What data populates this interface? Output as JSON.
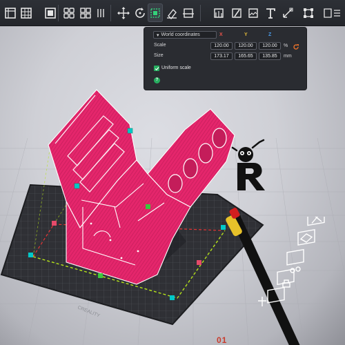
{
  "toolbar": {
    "buttons": [
      {
        "icon": "cube-icon"
      },
      {
        "icon": "grid-layout-icon"
      },
      {
        "icon": "image-icon"
      },
      {
        "icon": "arrange-icon"
      },
      {
        "icon": "split-objects-icon"
      },
      {
        "icon": "move-icon"
      },
      {
        "icon": "rotate-icon"
      },
      {
        "icon": "scale-icon"
      },
      {
        "icon": "place-on-face-icon"
      },
      {
        "icon": "cut-icon"
      },
      {
        "icon": "support-painting-icon"
      },
      {
        "icon": "seam-painting-icon"
      },
      {
        "icon": "fuzzy-skin-icon"
      },
      {
        "icon": "text-tool-icon"
      },
      {
        "icon": "measure-icon"
      },
      {
        "icon": "assembly-icon"
      }
    ],
    "active_tool": "scale-icon"
  },
  "scale_panel": {
    "coordinate_system": "World coordinates",
    "axes": {
      "x": "X",
      "y": "Y",
      "z": "Z"
    },
    "axis_colors": {
      "x": "#e8534a",
      "y": "#e2b93b",
      "z": "#4a9bea"
    },
    "scale_label": "Scale",
    "scale": {
      "x": "120.00",
      "y": "120.00",
      "z": "120.00"
    },
    "scale_unit": "%",
    "size_label": "Size",
    "size": {
      "x": "173.17",
      "y": "165.65",
      "z": "135.85"
    },
    "size_unit": "mm",
    "uniform_scale_label": "Uniform scale",
    "uniform_scale": true,
    "help_glyph": "?"
  },
  "scene": {
    "model_color": "#e5266c",
    "bed_brand": "CREALITY",
    "plate_number": "01",
    "accent_handle_color": "#00c8c8"
  },
  "side_toolbar": [
    {
      "icon": "delete-plate-icon"
    },
    {
      "icon": "orient-icon"
    },
    {
      "icon": "arrange-plate-icon"
    },
    {
      "icon": "lock-plate-icon"
    },
    {
      "icon": "plate-settings-icon"
    },
    {
      "icon": "move-plate-icon"
    }
  ]
}
